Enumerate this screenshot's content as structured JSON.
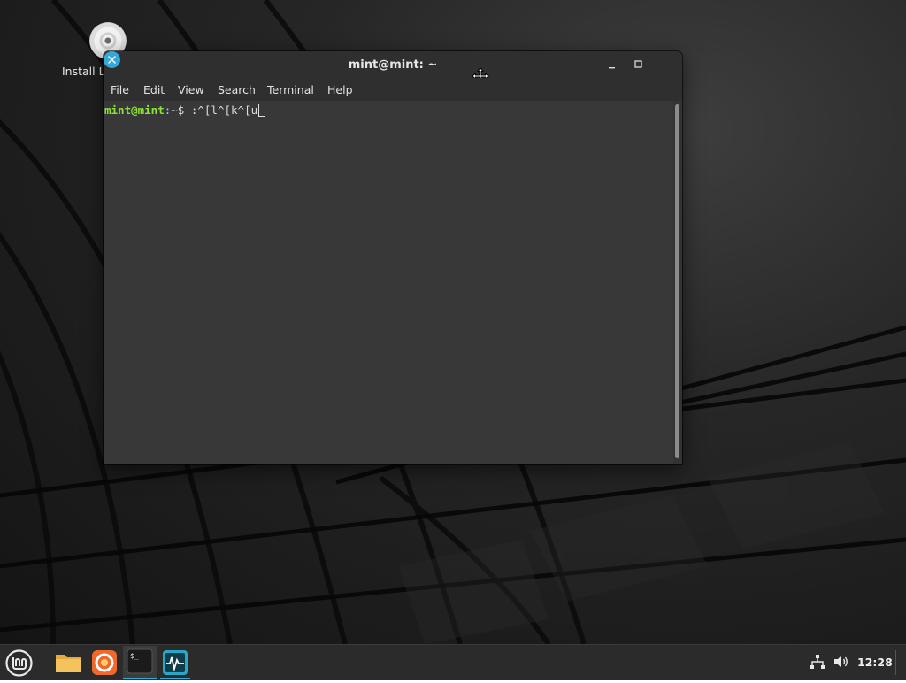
{
  "desktop": {
    "icons": [
      {
        "label": "Install L",
        "icon": "disc-icon"
      }
    ]
  },
  "terminal": {
    "title": "mint@mint: ~",
    "menu": [
      "File",
      "Edit",
      "View",
      "Search",
      "Terminal",
      "Help"
    ],
    "prompt_user": "mint@mint",
    "prompt_path": ":~",
    "prompt_symbol": "$ ",
    "command_input": ":^[l^[k^[u",
    "colors": {
      "prompt_user": "#8ae234",
      "close_button": "#35a7d8",
      "background": "#383838"
    }
  },
  "taskbar": {
    "launchers": [
      {
        "name": "menu-icon"
      },
      {
        "name": "files-folder-icon"
      },
      {
        "name": "firefox-icon"
      },
      {
        "name": "terminal-icon",
        "active": true
      },
      {
        "name": "system-monitor-icon"
      }
    ],
    "tray": {
      "network_icon": "network-icon",
      "volume_icon": "volume-icon",
      "clock": "12:28"
    },
    "accent": "#35a7d8"
  }
}
